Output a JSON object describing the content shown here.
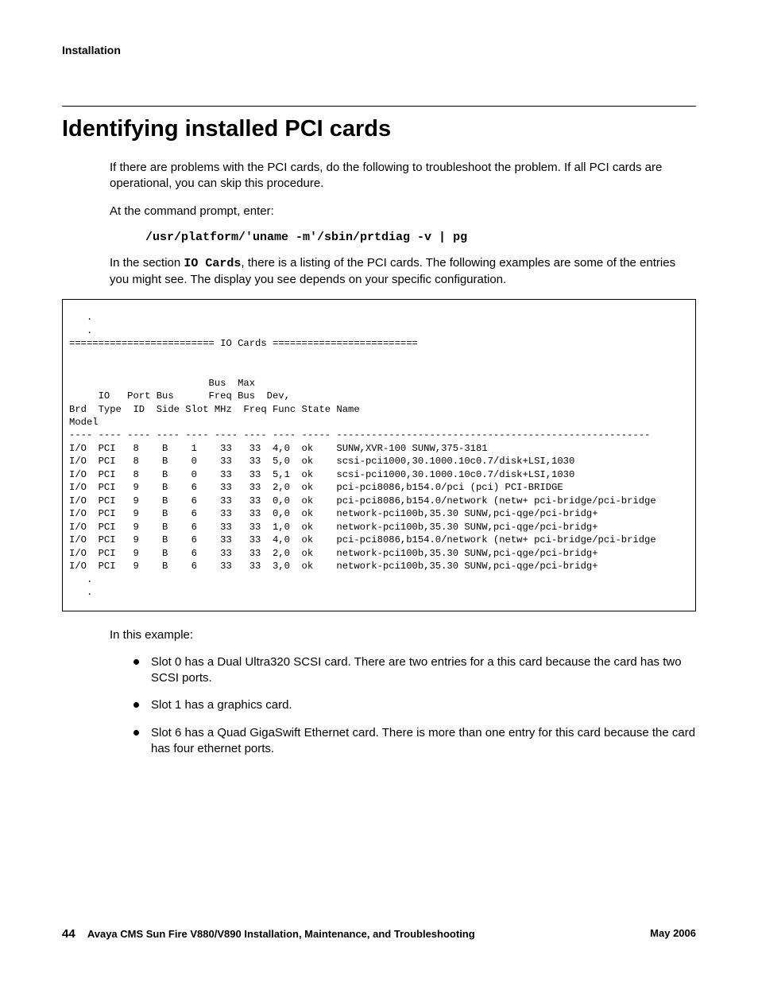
{
  "header": {
    "section": "Installation"
  },
  "title": "Identifying installed PCI cards",
  "intro1": "If there are problems with the PCI cards, do the following to troubleshoot the problem. If all PCI cards are operational, you can skip this procedure.",
  "intro2": "At the command prompt, enter:",
  "command": "/usr/platform/'uname -m'/sbin/prtdiag -v | pg",
  "intro3a": "In the section ",
  "intro3code": "IO Cards",
  "intro3b": ", there is a listing of the PCI cards. The following examples are some of the entries you might see. The display you see depends on your specific configuration.",
  "code_block": "   .\n   .\n========================= IO Cards =========================\n\n\n                        Bus  Max\n     IO   Port Bus      Freq Bus  Dev,\nBrd  Type  ID  Side Slot MHz  Freq Func State Name\nModel\n---- ---- ---- ---- ---- ---- ---- ---- ----- ------------------------------------------------------\nI/O  PCI   8    B    1    33   33  4,0  ok    SUNW,XVR-100 SUNW,375-3181\nI/O  PCI   8    B    0    33   33  5,0  ok    scsi-pci1000,30.1000.10c0.7/disk+LSI,1030\nI/O  PCI   8    B    0    33   33  5,1  ok    scsi-pci1000,30.1000.10c0.7/disk+LSI,1030\nI/O  PCI   9    B    6    33   33  2,0  ok    pci-pci8086,b154.0/pci (pci) PCI-BRIDGE\nI/O  PCI   9    B    6    33   33  0,0  ok    pci-pci8086,b154.0/network (netw+ pci-bridge/pci-bridge\nI/O  PCI   9    B    6    33   33  0,0  ok    network-pci100b,35.30 SUNW,pci-qge/pci-bridg+\nI/O  PCI   9    B    6    33   33  1,0  ok    network-pci100b,35.30 SUNW,pci-qge/pci-bridg+\nI/O  PCI   9    B    6    33   33  4,0  ok    pci-pci8086,b154.0/network (netw+ pci-bridge/pci-bridge\nI/O  PCI   9    B    6    33   33  2,0  ok    network-pci100b,35.30 SUNW,pci-qge/pci-bridg+\nI/O  PCI   9    B    6    33   33  3,0  ok    network-pci100b,35.30 SUNW,pci-qge/pci-bridg+\n   .\n   .",
  "example_label": "In this example:",
  "bullets": [
    "Slot 0 has a Dual Ultra320 SCSI card. There are two entries for a this card because the card has two SCSI ports.",
    "Slot 1 has a graphics card.",
    "Slot 6 has a Quad GigaSwift Ethernet card. There is more than one entry for this card because the card has four ethernet ports."
  ],
  "footer": {
    "page": "44",
    "doc": "Avaya CMS Sun Fire V880/V890 Installation, Maintenance, and Troubleshooting",
    "date": "May 2006"
  }
}
